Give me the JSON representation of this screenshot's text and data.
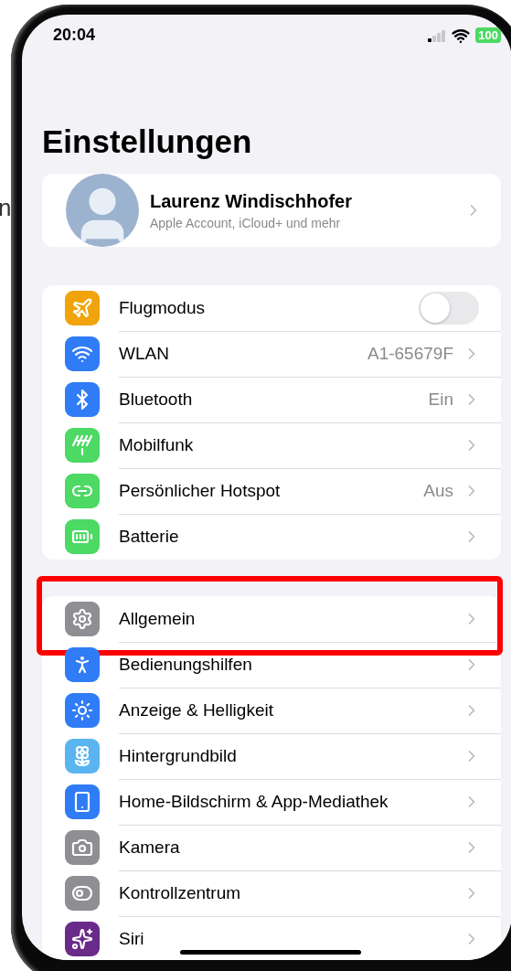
{
  "backdrop_text": "n",
  "status_bar": {
    "time": "20:04",
    "battery": "100"
  },
  "title": "Einstellungen",
  "profile": {
    "name": "Laurenz Windischhofer",
    "subtitle": "Apple Account, iCloud+ und mehr"
  },
  "groups": [
    {
      "items": [
        {
          "kind": "toggle",
          "label": "Flugmodus",
          "on": false,
          "color": "#f0a30a",
          "highlighted": false
        },
        {
          "kind": "link",
          "label": "WLAN",
          "value": "A1-65679F",
          "color": "#2f7cf6",
          "highlighted": false
        },
        {
          "kind": "link",
          "label": "Bluetooth",
          "value": "Ein",
          "color": "#2f7cf6",
          "highlighted": false
        },
        {
          "kind": "link",
          "label": "Mobilfunk",
          "color": "#4cd964",
          "highlighted": false
        },
        {
          "kind": "link",
          "label": "Persönlicher Hotspot",
          "value": "Aus",
          "color": "#4cd964",
          "highlighted": false
        },
        {
          "kind": "link",
          "label": "Batterie",
          "color": "#4cd964",
          "highlighted": false
        }
      ]
    },
    {
      "items": [
        {
          "kind": "link",
          "label": "Allgemein",
          "color": "#8e8e93",
          "highlighted": true
        },
        {
          "kind": "link",
          "label": "Bedienungshilfen",
          "color": "#2f7cf6",
          "highlighted": false
        },
        {
          "kind": "link",
          "label": "Anzeige & Helligkeit",
          "color": "#2f7cf6",
          "highlighted": false
        },
        {
          "kind": "link",
          "label": "Hintergrundbild",
          "color": "#5ab4f0",
          "highlighted": false
        },
        {
          "kind": "link",
          "label": "Home-Bildschirm & App-Mediathek",
          "color": "#2f7cf6",
          "highlighted": false
        },
        {
          "kind": "link",
          "label": "Kamera",
          "color": "#8e8e93",
          "highlighted": false
        },
        {
          "kind": "link",
          "label": "Kontrollzentrum",
          "color": "#8e8e93",
          "highlighted": false
        },
        {
          "kind": "link",
          "label": "Siri",
          "color": "#6a2a8a",
          "highlighted": false
        }
      ]
    }
  ]
}
